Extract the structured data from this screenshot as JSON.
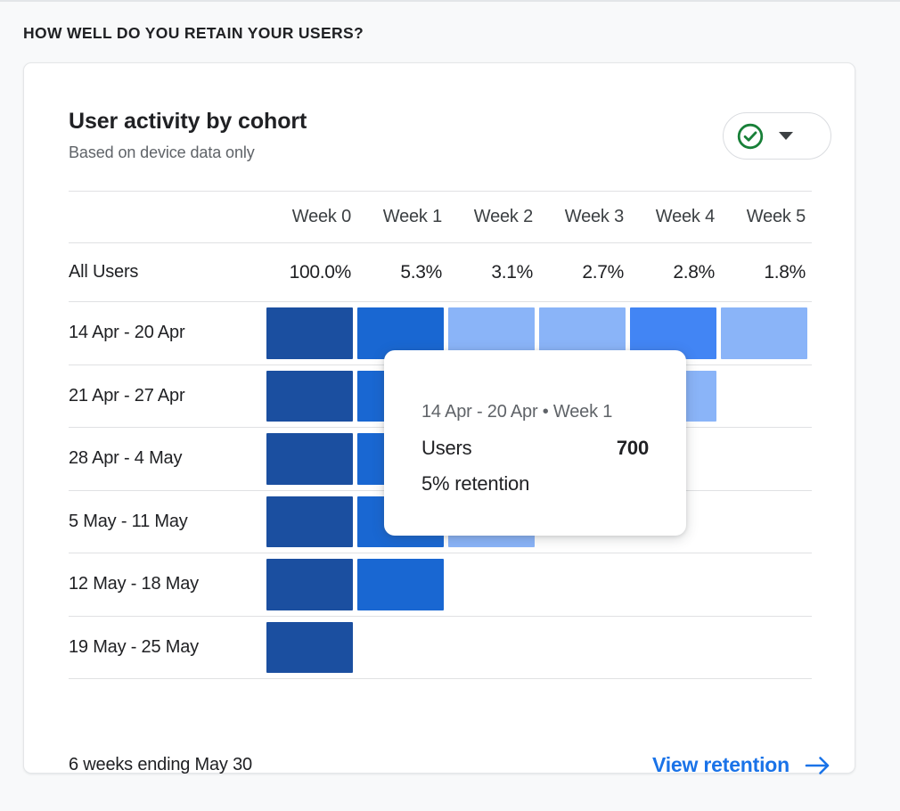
{
  "section": {
    "heading": "HOW WELL DO YOU RETAIN YOUR USERS?"
  },
  "card": {
    "title": "User activity by cohort",
    "subtitle": "Based on device data only",
    "toggle": {
      "status_icon": "check-circle-icon",
      "status_color": "#188038",
      "dropdown_icon": "chevron-down-icon"
    },
    "footer_note": "6 weeks ending May 30",
    "link_label": "View retention",
    "link_icon": "arrow-right-icon",
    "link_color": "#1a73e8"
  },
  "tooltip": {
    "header": "14 Apr - 20 Apr • Week 1",
    "metric_label": "Users",
    "metric_value": "700",
    "note": "5% retention"
  },
  "chart_data": {
    "type": "heatmap",
    "title": "User activity by cohort",
    "subtitle": "Based on device data only",
    "xlabel": "",
    "ylabel": "",
    "categories": [
      "Week 0",
      "Week 1",
      "Week 2",
      "Week 3",
      "Week 4",
      "Week 5"
    ],
    "summary_row": {
      "label": "All Users",
      "values": [
        "100.0%",
        "5.3%",
        "3.1%",
        "2.7%",
        "2.8%",
        "1.8%"
      ]
    },
    "rows": [
      {
        "label": "14 Apr - 20 Apr",
        "cells": [
          {
            "week": "Week 0",
            "color": "#1b4fa0"
          },
          {
            "week": "Week 1",
            "color": "#1967d2"
          },
          {
            "week": "Week 2",
            "color": "#8ab4f8"
          },
          {
            "week": "Week 3",
            "color": "#8ab4f8"
          },
          {
            "week": "Week 4",
            "color": "#4285f4"
          },
          {
            "week": "Week 5",
            "color": "#8ab4f8"
          }
        ]
      },
      {
        "label": "21 Apr - 27 Apr",
        "cells": [
          {
            "week": "Week 0",
            "color": "#1b4fa0"
          },
          {
            "week": "Week 1",
            "color": "#1967d2"
          },
          {
            "week": "Week 2",
            "color": "#8ab4f8"
          },
          {
            "week": "Week 3",
            "color": "#8ab4f8"
          },
          {
            "week": "Week 4",
            "color": "#8ab4f8"
          }
        ]
      },
      {
        "label": "28 Apr - 4 May",
        "cells": [
          {
            "week": "Week 0",
            "color": "#1b4fa0"
          },
          {
            "week": "Week 1",
            "color": "#1967d2"
          },
          {
            "week": "Week 2",
            "color": "#8ab4f8"
          },
          {
            "week": "Week 3",
            "color": "#8ab4f8"
          }
        ]
      },
      {
        "label": "5 May - 11 May",
        "cells": [
          {
            "week": "Week 0",
            "color": "#1b4fa0"
          },
          {
            "week": "Week 1",
            "color": "#1967d2"
          },
          {
            "week": "Week 2",
            "color": "#8ab4f8"
          }
        ]
      },
      {
        "label": "12 May - 18 May",
        "cells": [
          {
            "week": "Week 0",
            "color": "#1b4fa0"
          },
          {
            "week": "Week 1",
            "color": "#1967d2"
          }
        ]
      },
      {
        "label": "19 May - 25 May",
        "cells": [
          {
            "week": "Week 0",
            "color": "#1b4fa0"
          }
        ]
      }
    ],
    "hovered": {
      "row": "14 Apr - 20 Apr",
      "column": "Week 1",
      "users": 700,
      "retention_pct": 5
    },
    "footer": "6 weeks ending May 30"
  }
}
